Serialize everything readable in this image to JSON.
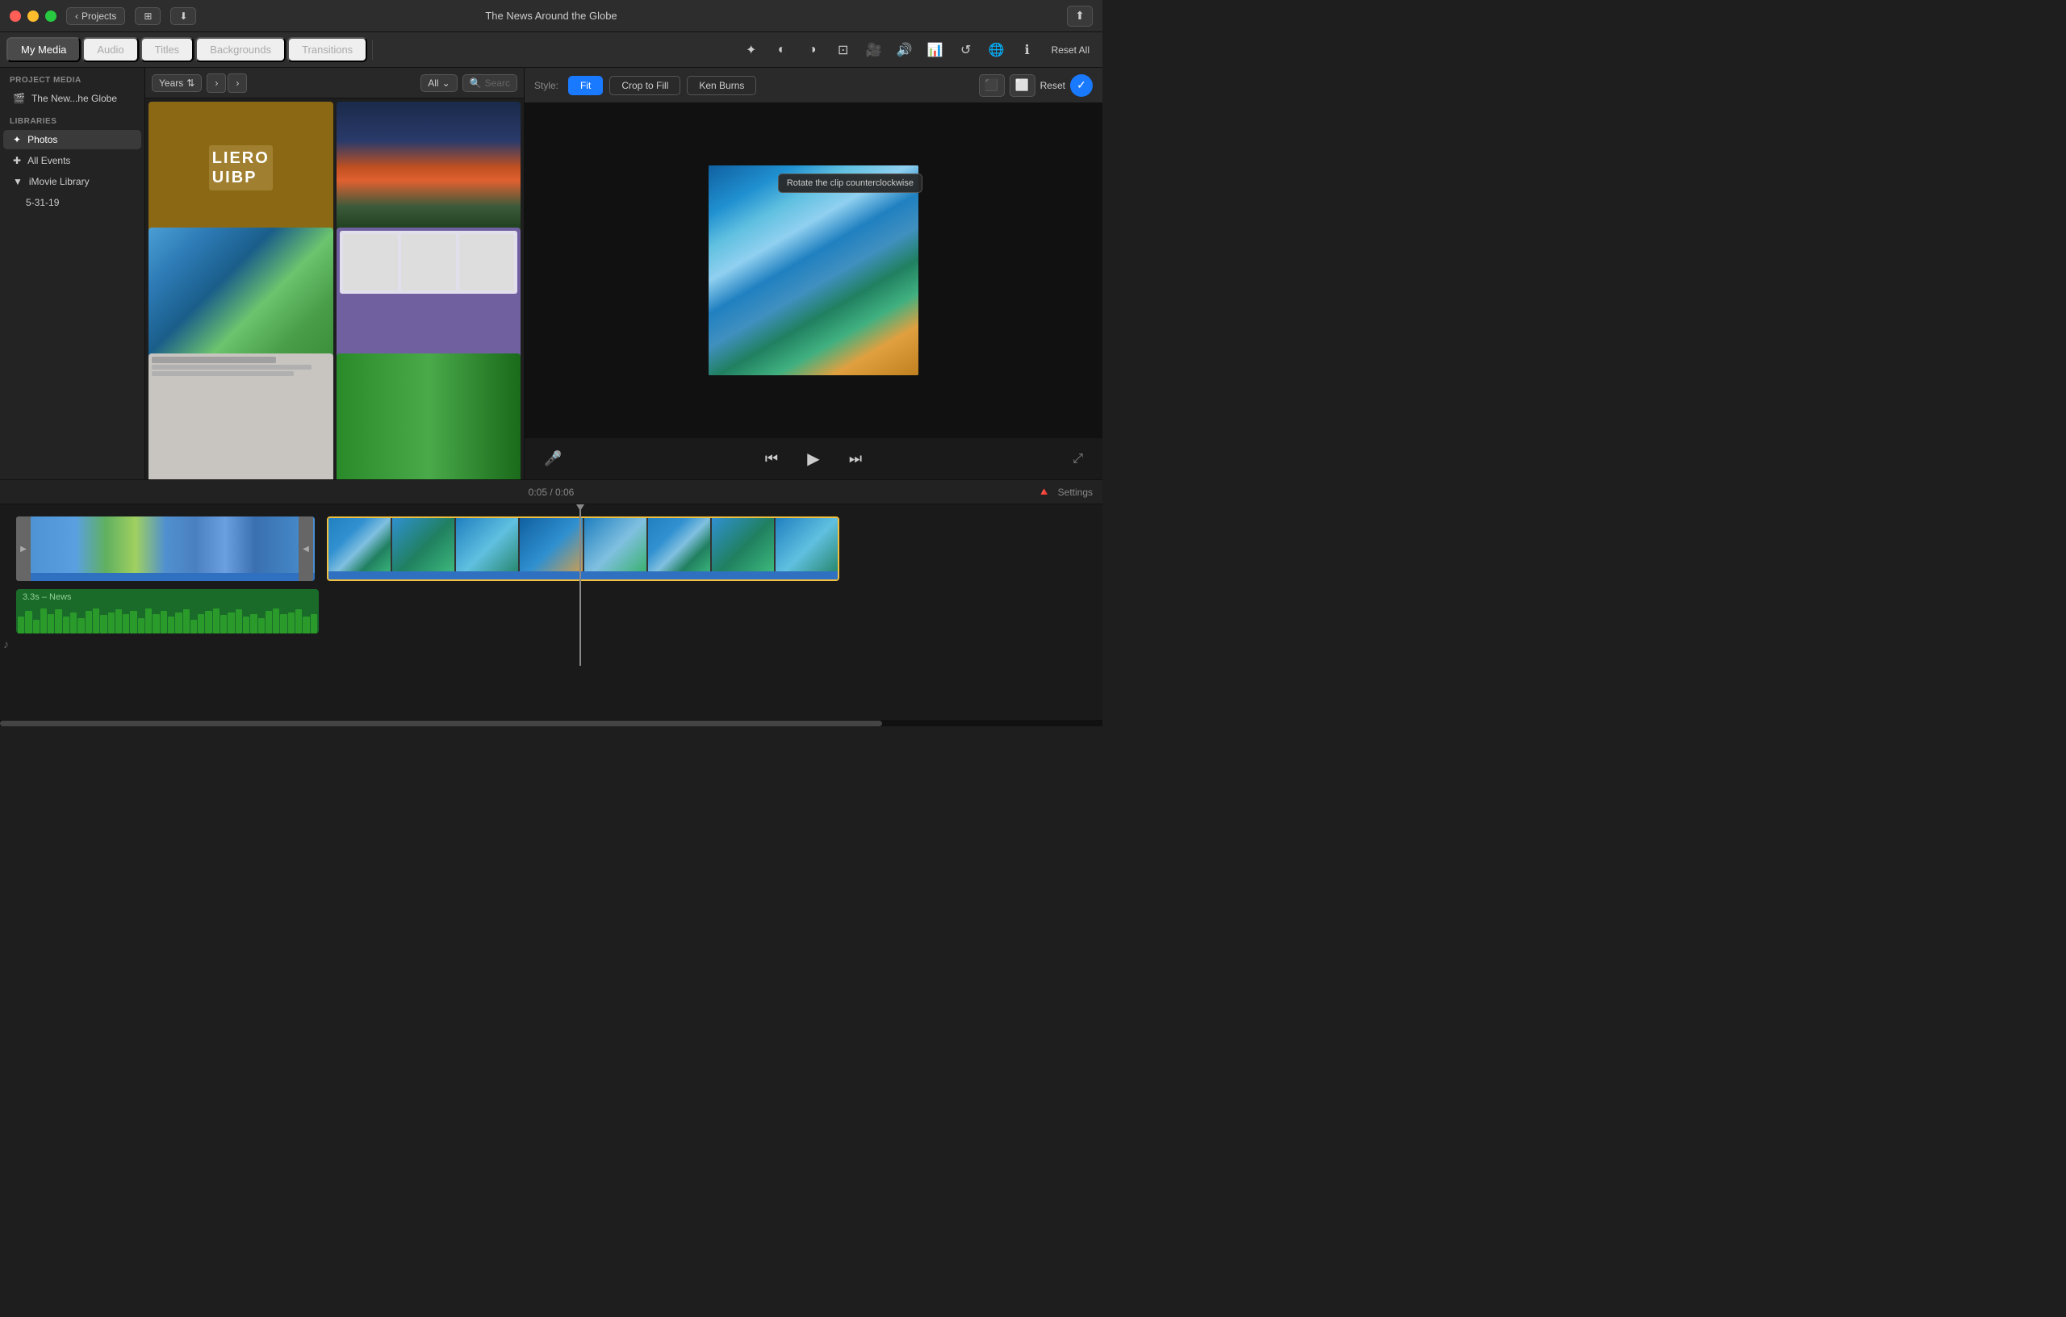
{
  "titlebar": {
    "title": "The News Around the Globe",
    "back_label": "Projects",
    "icon_grid": "⊞",
    "icon_down": "⬇"
  },
  "tabs": {
    "active": "My Media",
    "items": [
      "My Media",
      "Audio",
      "Titles",
      "Backgrounds",
      "Transitions"
    ]
  },
  "toolbar_icons": {
    "magic": "✦",
    "halfcircle": "◐",
    "colors": "🎨",
    "crop": "⊡",
    "camera": "📷",
    "volume": "🔊",
    "bars": "📊",
    "refresh": "↺",
    "globe": "🌐",
    "info": "ℹ",
    "reset_all": "Reset All"
  },
  "media_panel": {
    "years_label": "Years",
    "all_label": "All",
    "search_placeholder": "Search",
    "search_icon": "🔍"
  },
  "preview_panel": {
    "style_label": "Style:",
    "style_fit": "Fit",
    "style_crop": "Crop to Fill",
    "style_ken": "Ken Burns",
    "reset_label": "Reset",
    "tooltip_text": "Rotate the clip counterclockwise",
    "time_current": "0:05",
    "time_total": "0:06"
  },
  "sidebar": {
    "project_media_label": "PROJECT MEDIA",
    "project_item": "The New...he Globe",
    "libraries_label": "LIBRARIES",
    "library_photos": "Photos",
    "library_all_events": "All Events",
    "library_imovie": "iMovie Library",
    "library_date": "5-31-19"
  },
  "timeline": {
    "time_display": "0:05 / 0:06",
    "settings_label": "Settings",
    "audio_clip_label": "3.3s – News"
  }
}
